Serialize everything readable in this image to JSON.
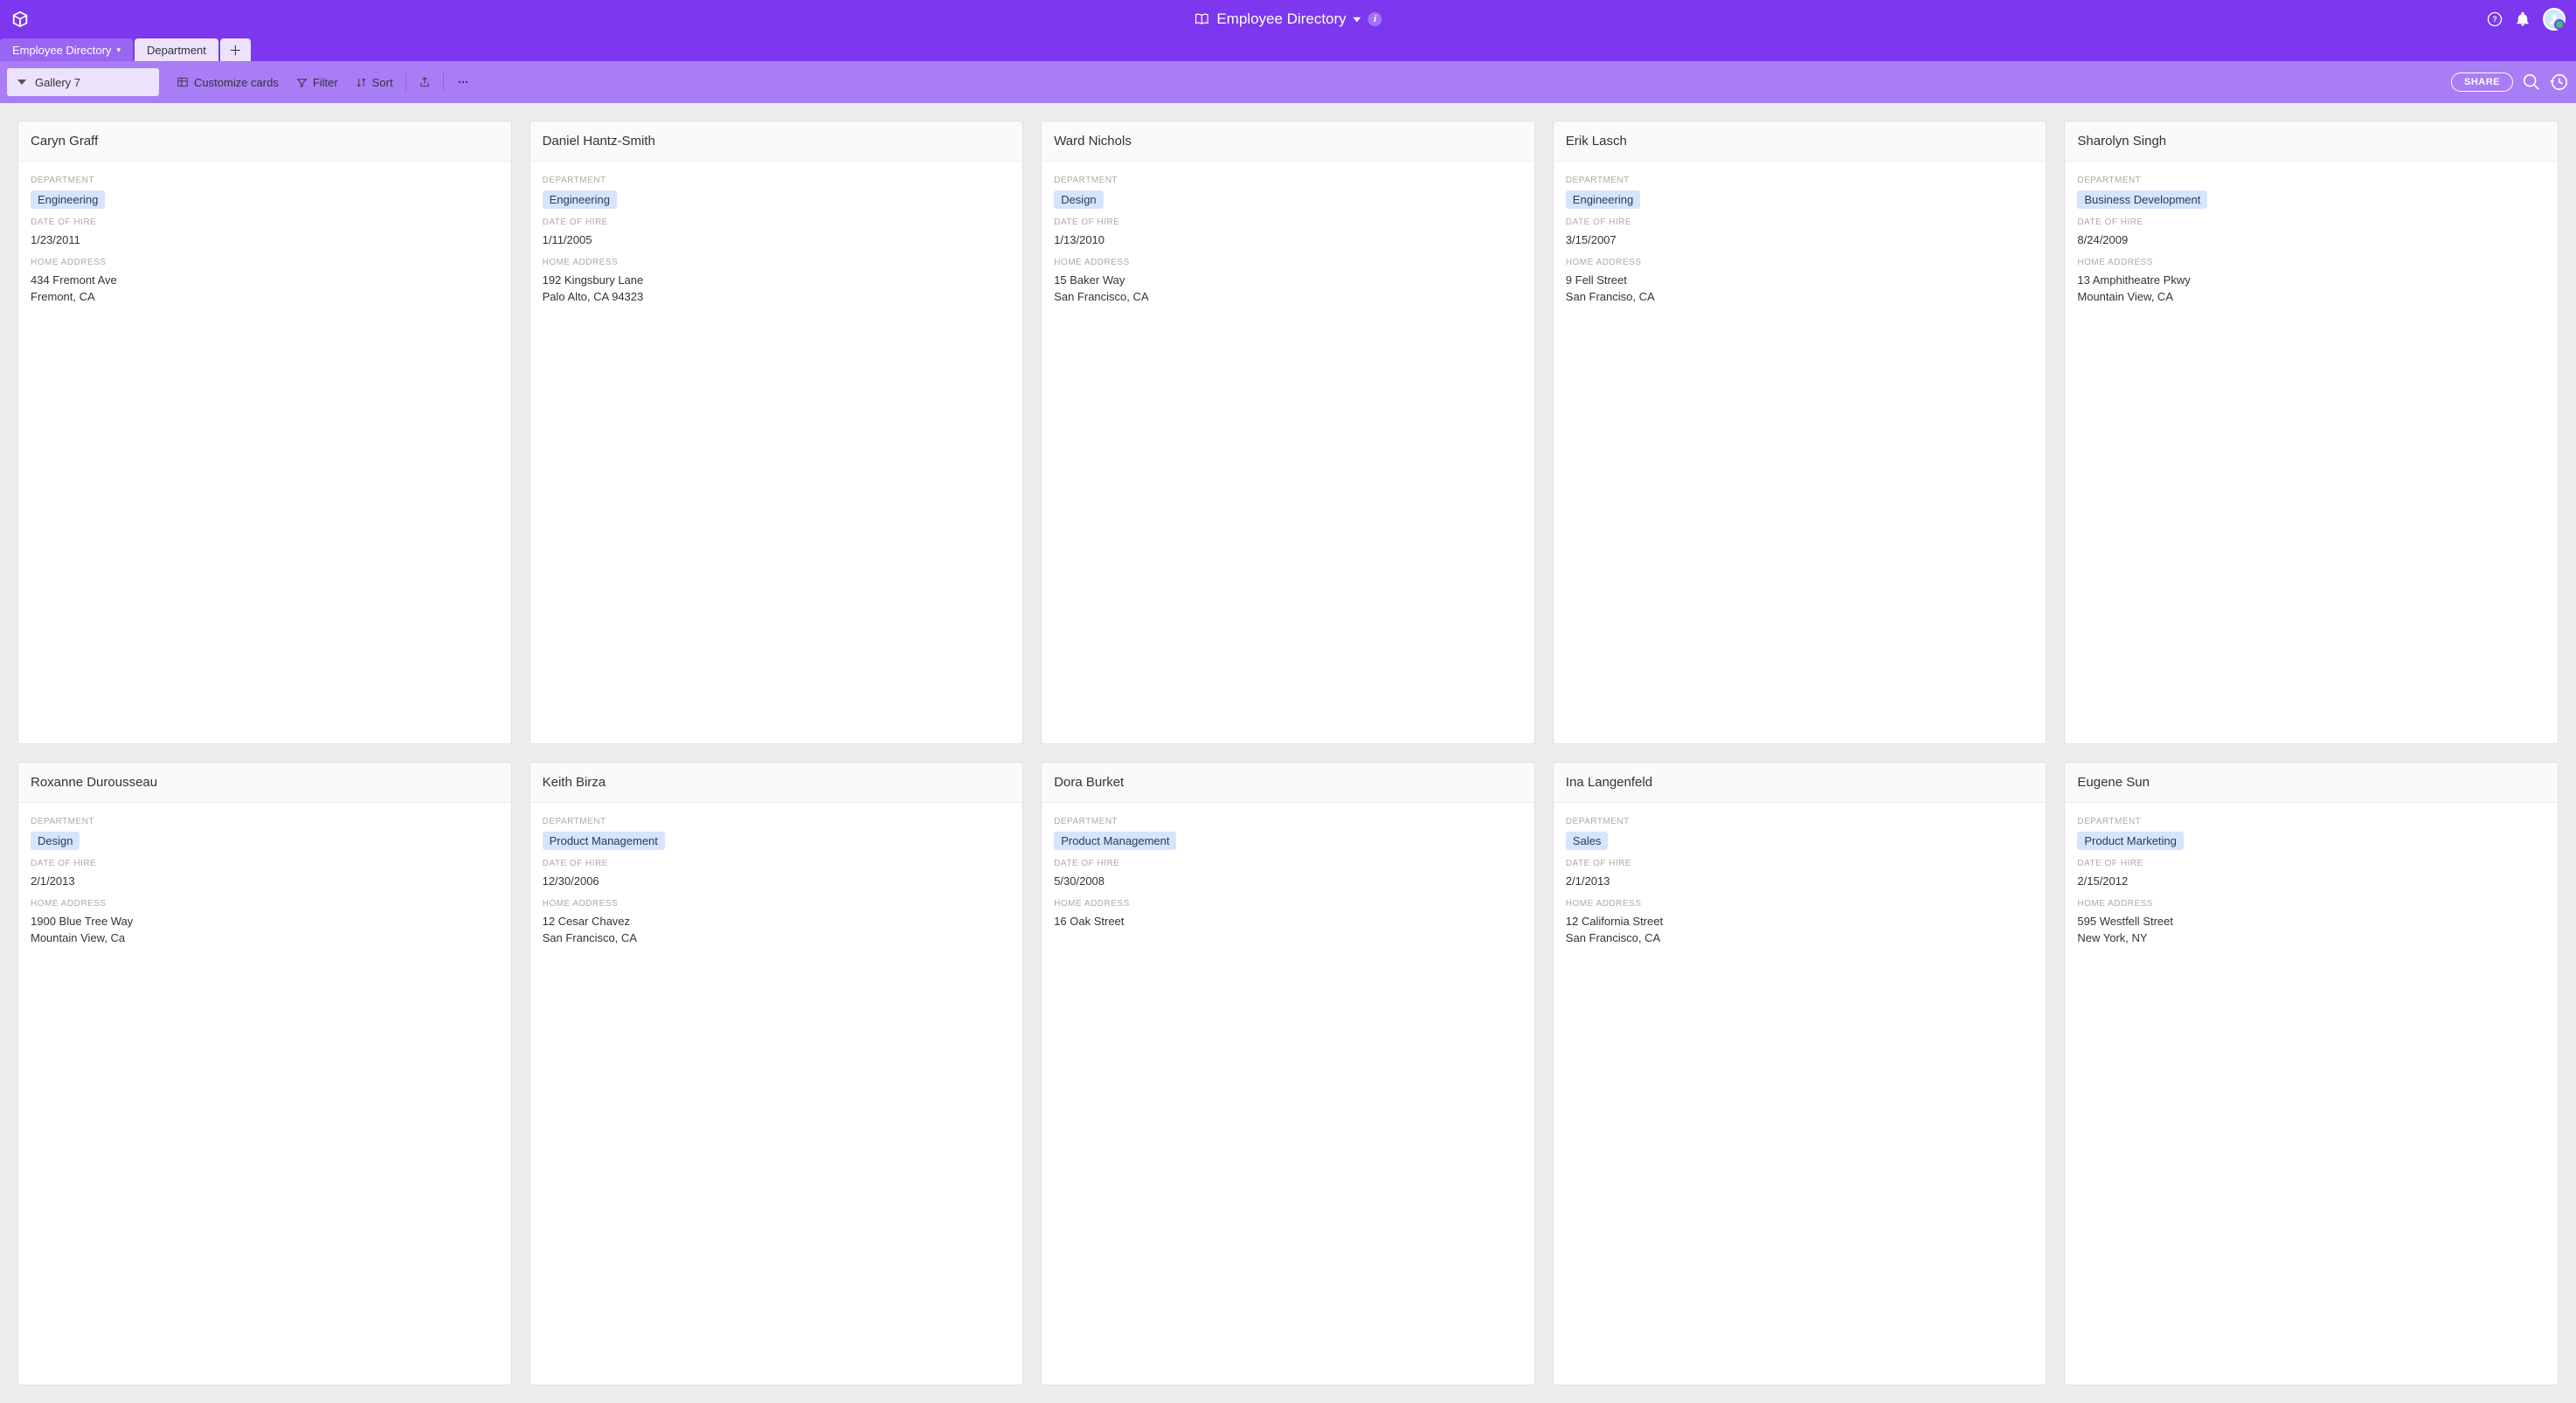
{
  "header": {
    "title": "Employee Directory"
  },
  "tabs": [
    {
      "label": "Employee Directory",
      "active": true,
      "has_caret": true
    },
    {
      "label": "Department",
      "active": false,
      "has_caret": false
    }
  ],
  "toolbar": {
    "view_name": "Gallery 7",
    "customize_label": "Customize cards",
    "filter_label": "Filter",
    "sort_label": "Sort",
    "share_label": "SHARE"
  },
  "field_labels": {
    "department": "DEPARTMENT",
    "date_of_hire": "DATE OF HIRE",
    "home_address": "HOME ADDRESS"
  },
  "cards": [
    {
      "name": "Caryn Graff",
      "department": "Engineering",
      "date_of_hire": "1/23/2011",
      "home_address": "434 Fremont Ave\nFremont, CA"
    },
    {
      "name": "Daniel Hantz-Smith",
      "department": "Engineering",
      "date_of_hire": "1/11/2005",
      "home_address": "192 Kingsbury Lane\nPalo Alto, CA 94323"
    },
    {
      "name": "Ward Nichols",
      "department": "Design",
      "date_of_hire": "1/13/2010",
      "home_address": "15 Baker Way\nSan Francisco, CA"
    },
    {
      "name": "Erik Lasch",
      "department": "Engineering",
      "date_of_hire": "3/15/2007",
      "home_address": "9 Fell Street\nSan Franciso, CA"
    },
    {
      "name": "Sharolyn Singh",
      "department": "Business Development",
      "date_of_hire": "8/24/2009",
      "home_address": "13 Amphitheatre Pkwy\nMountain View, CA"
    },
    {
      "name": "Roxanne Durousseau",
      "department": "Design",
      "date_of_hire": "2/1/2013",
      "home_address": "1900 Blue Tree Way\nMountain View, Ca"
    },
    {
      "name": "Keith Birza",
      "department": "Product Management",
      "date_of_hire": "12/30/2006",
      "home_address": "12 Cesar Chavez\nSan Francisco, CA"
    },
    {
      "name": "Dora Burket",
      "department": "Product Management",
      "date_of_hire": "5/30/2008",
      "home_address": "16 Oak Street"
    },
    {
      "name": "Ina Langenfeld",
      "department": "Sales",
      "date_of_hire": "2/1/2013",
      "home_address": "12 California Street\nSan Francisco, CA"
    },
    {
      "name": "Eugene Sun",
      "department": "Product Marketing",
      "date_of_hire": "2/15/2012",
      "home_address": "595 Westfell Street\nNew York, NY"
    }
  ],
  "colors": {
    "primary": "#7c37ef",
    "primary_light": "#a97df5",
    "primary_pale": "#ece2fc",
    "pill_bg": "#d6e4ff"
  }
}
